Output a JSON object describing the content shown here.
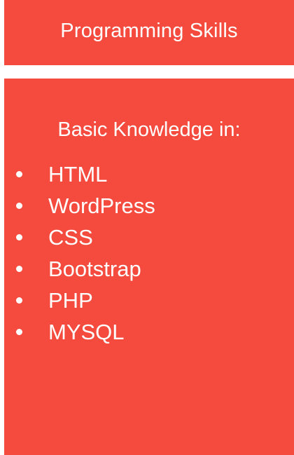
{
  "header": {
    "title": "Programming Skills"
  },
  "panel": {
    "heading": "Basic Knowledge in:",
    "skills": [
      "HTML",
      "WordPress",
      "CSS",
      "Bootstrap",
      "PHP",
      "MYSQL"
    ]
  },
  "colors": {
    "accent": "#f44b3e",
    "text": "#ffffff",
    "background": "#ffffff"
  }
}
